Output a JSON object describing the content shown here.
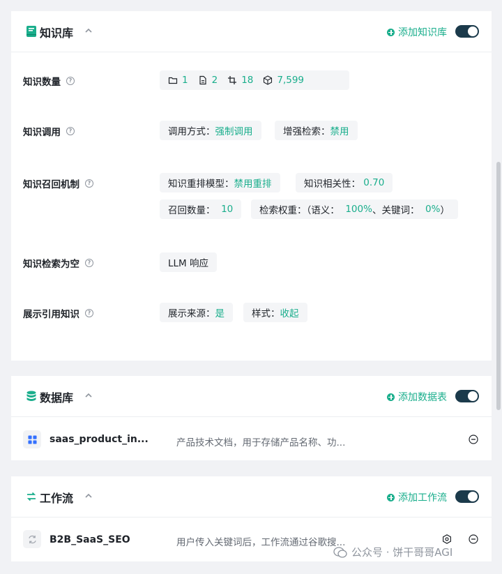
{
  "knowledge": {
    "title": "知识库",
    "add_label": "添加知识库",
    "toggle_on": true,
    "count": {
      "label": "知识数量",
      "folders": "1",
      "documents": "2",
      "slices": "18",
      "tokens": "7,599"
    },
    "invoke": {
      "label": "知识调用",
      "mode_key": "调用方式：",
      "mode_value": "强制调用",
      "enhance_key": "增强检索：",
      "enhance_value": "禁用"
    },
    "recall": {
      "label": "知识召回机制",
      "rerank_key": "知识重排模型：",
      "rerank_value": "禁用重排",
      "relevance_key": "知识相关性：",
      "relevance_value": "0.70",
      "count_key": "召回数量：",
      "count_value": "10",
      "weight_key": "检索权重：（语义：",
      "semantic_value": "100%",
      "keyword_key": "、关键词：",
      "keyword_value": "0%",
      "close_paren": "）"
    },
    "empty": {
      "label": "知识检索为空",
      "value": "LLM 响应"
    },
    "cite": {
      "label": "展示引用知识",
      "source_key": "展示来源：",
      "source_value": "是",
      "style_key": "样式：",
      "style_value": "收起"
    }
  },
  "database": {
    "title": "数据库",
    "add_label": "添加数据表",
    "toggle_on": true,
    "items": [
      {
        "name": "saas_product_in...",
        "desc": "产品技术文档，用于存储产品名称、功..."
      }
    ]
  },
  "workflow": {
    "title": "工作流",
    "add_label": "添加工作流",
    "toggle_on": true,
    "items": [
      {
        "name": "B2B_SaaS_SEO",
        "desc": "用户传入关键词后，工作流通过谷歌搜..."
      }
    ]
  },
  "watermark": "公众号 · 饼干哥哥AGI",
  "colors": {
    "accent": "#1aae8c",
    "toggle": "#1b3a4b"
  }
}
